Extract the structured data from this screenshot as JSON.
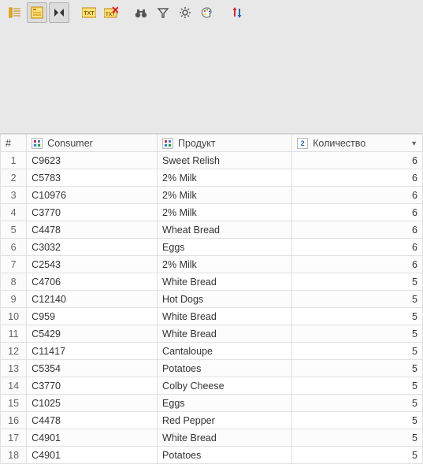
{
  "columns": {
    "rownum": "#",
    "consumer": "Consumer",
    "product": "Продукт",
    "quantity": "Количество"
  },
  "sort_indicator": "▼",
  "rows": [
    {
      "n": "1",
      "consumer": "C9623",
      "product": "Sweet Relish",
      "qty": "6"
    },
    {
      "n": "2",
      "consumer": "C5783",
      "product": "2% Milk",
      "qty": "6"
    },
    {
      "n": "3",
      "consumer": "C10976",
      "product": "2% Milk",
      "qty": "6"
    },
    {
      "n": "4",
      "consumer": "C3770",
      "product": "2% Milk",
      "qty": "6"
    },
    {
      "n": "5",
      "consumer": "C4478",
      "product": "Wheat Bread",
      "qty": "6"
    },
    {
      "n": "6",
      "consumer": "C3032",
      "product": "Eggs",
      "qty": "6"
    },
    {
      "n": "7",
      "consumer": "C2543",
      "product": "2% Milk",
      "qty": "6"
    },
    {
      "n": "8",
      "consumer": "C4706",
      "product": "White Bread",
      "qty": "5"
    },
    {
      "n": "9",
      "consumer": "C12140",
      "product": "Hot Dogs",
      "qty": "5"
    },
    {
      "n": "10",
      "consumer": "C959",
      "product": "White Bread",
      "qty": "5"
    },
    {
      "n": "11",
      "consumer": "C5429",
      "product": "White Bread",
      "qty": "5"
    },
    {
      "n": "12",
      "consumer": "C11417",
      "product": "Cantaloupe",
      "qty": "5"
    },
    {
      "n": "13",
      "consumer": "C5354",
      "product": "Potatoes",
      "qty": "5"
    },
    {
      "n": "14",
      "consumer": "C3770",
      "product": "Colby Cheese",
      "qty": "5"
    },
    {
      "n": "15",
      "consumer": "C1025",
      "product": "Eggs",
      "qty": "5"
    },
    {
      "n": "16",
      "consumer": "C4478",
      "product": "Red Pepper",
      "qty": "5"
    },
    {
      "n": "17",
      "consumer": "C4901",
      "product": "White Bread",
      "qty": "5"
    },
    {
      "n": "18",
      "consumer": "C4901",
      "product": "Potatoes",
      "qty": "5"
    }
  ]
}
